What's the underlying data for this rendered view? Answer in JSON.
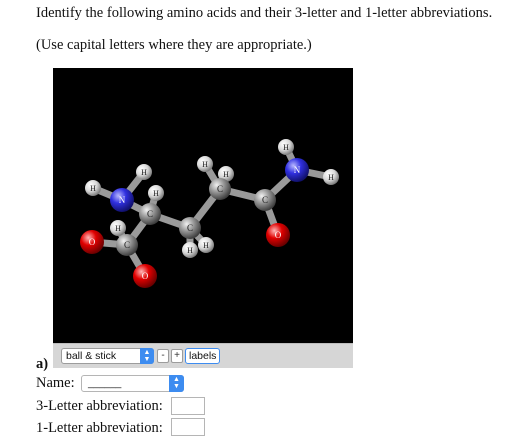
{
  "question": {
    "line1": "Identify the following amino acids and their 3-letter and 1-letter abbreviations.",
    "line2": "(Use capital letters where they are appropriate.)"
  },
  "viewer": {
    "style_select": "ball & stick",
    "minus": "-",
    "plus": "+",
    "labels_button": "labels",
    "atom_labels": {
      "H": "H",
      "N": "N",
      "C": "C",
      "O": "O"
    }
  },
  "part_a": {
    "label": "a)",
    "name_label": "Name:",
    "name_select": "______",
    "three_letter_label": "3-Letter abbreviation:",
    "one_letter_label": "1-Letter abbreviation:",
    "three_letter_value": "",
    "one_letter_value": ""
  },
  "colors": {
    "carbon": "#8a8a8a",
    "hydrogen": "#e6e6e6",
    "nitrogen": "#2b2bd8",
    "oxygen": "#e00000",
    "accent": "#3d8cf0"
  }
}
